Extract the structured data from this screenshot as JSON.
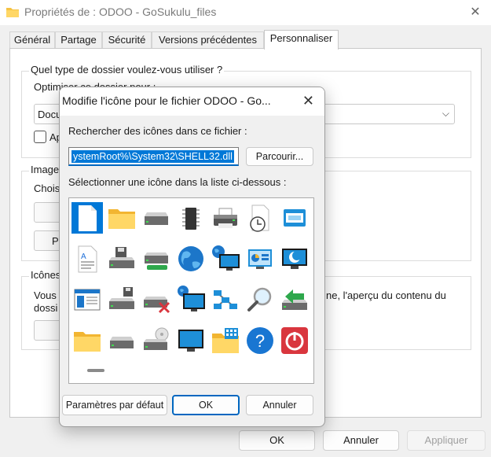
{
  "window": {
    "title": "Propriétés de : ODOO - GoSukulu_files",
    "close_glyph": "✕"
  },
  "tabs": [
    "Général",
    "Partage",
    "Sécurité",
    "Versions précédentes",
    "Personnaliser"
  ],
  "active_tab": "Personnaliser",
  "background": {
    "folder_type_question": "Quel type de dossier voulez-vous utiliser ?",
    "optimize_label": "Optimiser ce dossier pour :",
    "optimize_value_partial": "Docu",
    "apply_checkbox_partial": "Ap",
    "images_group_partial": "Image",
    "choose_partial": "Choisi",
    "icons_group_partial": "Icônes",
    "preview_line1_left": "Vous",
    "preview_line1_right": "ne, l'aperçu du contenu du",
    "preview_line2_left": "dossi",
    "button_partial": "P"
  },
  "footer": {
    "ok": "OK",
    "cancel": "Annuler",
    "apply": "Appliquer"
  },
  "dialog": {
    "title": "Modifie l'icône pour le fichier ODOO - Go...",
    "close_glyph": "✕",
    "search_label": "Rechercher des icônes dans ce fichier :",
    "path_value": "ystemRoot%\\System32\\SHELL32.dll",
    "browse_label": "Parcourir...",
    "select_label": "Sélectionner une icône dans la liste ci-dessous :",
    "defaults_label": "Paramètres par défaut",
    "ok_label": "OK",
    "cancel_label": "Annuler"
  },
  "icons": [
    "blank-document-icon",
    "folder-icon",
    "drive-icon",
    "chip-icon",
    "printer-icon",
    "clock-document-icon",
    "window-stack-icon",
    "text-document-icon",
    "floppy-drive-icon",
    "removable-drive-icon",
    "globe-icon",
    "network-monitor-icon",
    "control-panel-icon",
    "moon-monitor-icon",
    "application-window-icon",
    "floppy-drive-2-icon",
    "disconnected-drive-icon",
    "network-globe-monitor-icon",
    "network-nodes-icon",
    "magnifier-icon",
    "drive-arrow-icon",
    "folder-2-icon",
    "drive-2-icon",
    "cd-drive-icon",
    "monitor-icon",
    "folder-grid-icon",
    "help-icon",
    "power-icon"
  ],
  "colors": {
    "accent": "#0078d7",
    "selection": "#0078d7",
    "help_blue": "#1976d2",
    "power_red": "#d9363e"
  }
}
